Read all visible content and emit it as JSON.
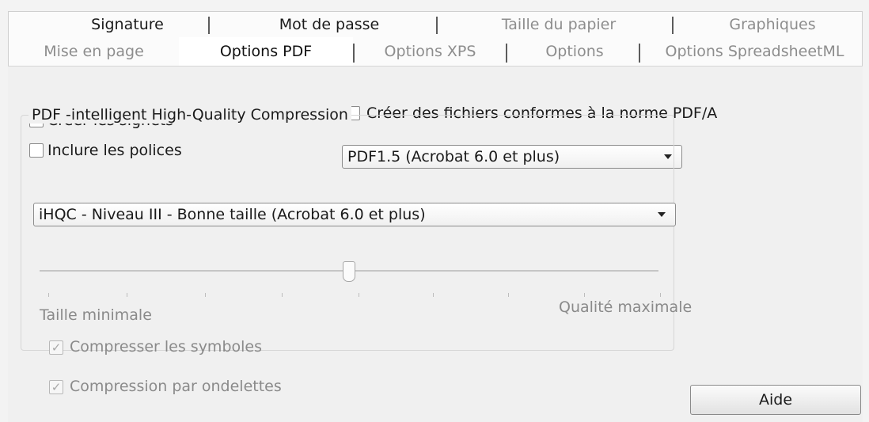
{
  "tabs_row1": [
    {
      "label": "Signature"
    },
    {
      "label": "Mot de passe"
    },
    {
      "label": "Taille du papier"
    },
    {
      "label": "Graphiques"
    }
  ],
  "tabs_row2": [
    {
      "label": "Mise en page"
    },
    {
      "label": "Options PDF"
    },
    {
      "label": "Options XPS"
    },
    {
      "label": "Options"
    },
    {
      "label": "Options SpreadsheetML"
    }
  ],
  "active_tab": "Options PDF",
  "options": {
    "create_bookmarks": {
      "label": "Créer les signets",
      "checked": true
    },
    "include_fonts": {
      "label": "Inclure les polices",
      "checked": false
    },
    "pdfa": {
      "label": "Créer des fichiers conformes à la norme PDF/A",
      "checked": false
    },
    "pdf_version": {
      "value": "PDF1.5 (Acrobat 6.0 et plus)"
    }
  },
  "compression": {
    "group_label": "PDF -intelligent High-Quality Compression",
    "level": {
      "value": "iHQC - Niveau III - Bonne taille (Acrobat 6.0 et plus)"
    },
    "slider": {
      "min_label": "Taille minimale",
      "max_label": "Qualité maximale",
      "position_fraction": 0.5
    },
    "compress_symbols": {
      "label": "Compresser les symboles",
      "checked": true,
      "disabled": true
    },
    "wavelet": {
      "label": "Compression par ondelettes",
      "checked": true,
      "disabled": true
    }
  },
  "help_button": {
    "label": "Aide"
  },
  "icons": {
    "check": "✓"
  }
}
